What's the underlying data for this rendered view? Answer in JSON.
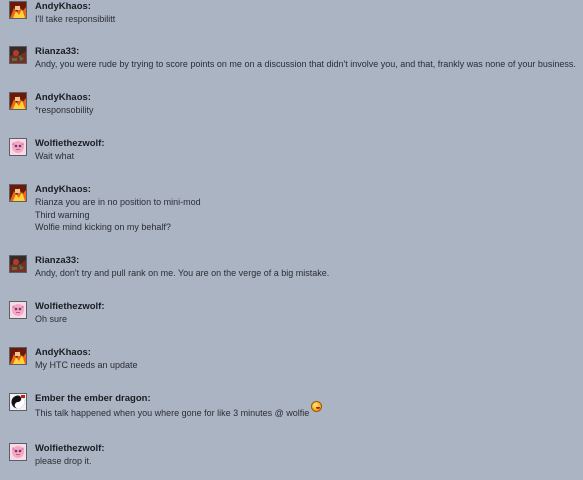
{
  "messages": [
    {
      "author": "AndyKhaos:",
      "avatar": "andykhaos-avatar",
      "lines": [
        "I'll take responsibilitt"
      ]
    },
    {
      "author": "Rianza33:",
      "avatar": "rianza33-avatar",
      "lines": [
        "Andy, you were rude by trying to score points on me on a discussion that didn't involve you, and that, frankly was none of your business."
      ]
    },
    {
      "author": "AndyKhaos:",
      "avatar": "andykhaos-avatar",
      "lines": [
        "*responsobility"
      ]
    },
    {
      "author": "Wolfiethezwolf:",
      "avatar": "wolfiethezwolf-avatar",
      "lines": [
        "Wait what"
      ]
    },
    {
      "author": "AndyKhaos:",
      "avatar": "andykhaos-avatar",
      "lines": [
        "Rianza you are in no position to mini-mod",
        "Third warning",
        "Wolfie mind kicking on my behalf?"
      ]
    },
    {
      "author": "Rianza33:",
      "avatar": "rianza33-avatar",
      "lines": [
        "Andy, don't try and pull rank on me. You are on the verge of a big mistake."
      ]
    },
    {
      "author": "Wolfiethezwolf:",
      "avatar": "wolfiethezwolf-avatar",
      "lines": [
        "Oh sure"
      ]
    },
    {
      "author": "AndyKhaos:",
      "avatar": "andykhaos-avatar",
      "lines": [
        "My HTC needs an update"
      ]
    },
    {
      "author": "Ember the ember dragon:",
      "avatar": "ember-avatar",
      "lines": [
        "This talk happened when you where gone for like 3 minutes @ wolfie"
      ],
      "emoji": "tongue-smiley-icon"
    },
    {
      "author": "Wolfiethezwolf:",
      "avatar": "wolfiethezwolf-avatar",
      "lines": [
        "please drop it."
      ]
    }
  ]
}
